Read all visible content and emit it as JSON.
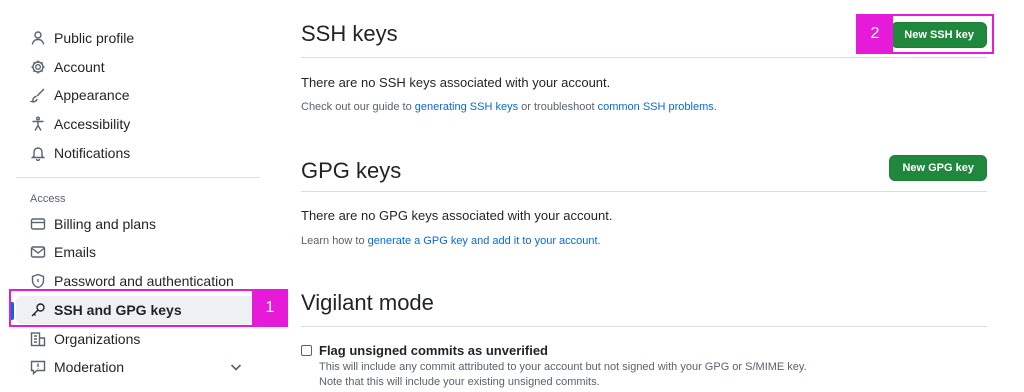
{
  "sidebar": {
    "items_top": [
      {
        "label": "Public profile",
        "icon": "person-icon"
      },
      {
        "label": "Account",
        "icon": "gear-icon"
      },
      {
        "label": "Appearance",
        "icon": "paintbrush-icon"
      },
      {
        "label": "Accessibility",
        "icon": "accessibility-icon"
      },
      {
        "label": "Notifications",
        "icon": "bell-icon"
      }
    ],
    "access_heading": "Access",
    "items_access": [
      {
        "label": "Billing and plans",
        "icon": "credit-card-icon"
      },
      {
        "label": "Emails",
        "icon": "mail-icon"
      },
      {
        "label": "Password and authentication",
        "icon": "shield-lock-icon"
      },
      {
        "label": "SSH and GPG keys",
        "icon": "key-icon",
        "active": true
      },
      {
        "label": "Organizations",
        "icon": "organization-icon"
      },
      {
        "label": "Moderation",
        "icon": "report-icon",
        "expandable": true
      }
    ]
  },
  "annotations": {
    "badge1": "1",
    "badge2": "2",
    "color": "#e61ad9"
  },
  "ssh": {
    "title": "SSH keys",
    "button": "New SSH key",
    "empty": "There are no SSH keys associated with your account.",
    "guide_prefix": "Check out our guide to ",
    "guide_link1": "generating SSH keys",
    "guide_mid": " or troubleshoot ",
    "guide_link2": "common SSH problems",
    "guide_suffix": "."
  },
  "gpg": {
    "title": "GPG keys",
    "button": "New GPG key",
    "empty": "There are no GPG keys associated with your account.",
    "learn_prefix": "Learn how to ",
    "learn_link": "generate a GPG key and add it to your account",
    "learn_suffix": "."
  },
  "vigilant": {
    "title": "Vigilant mode",
    "checkbox_label": "Flag unsigned commits as unverified",
    "checked": false,
    "desc1": "This will include any commit attributed to your account but not signed with your GPG or S/MIME key.",
    "desc2": "Note that this will include your existing unsigned commits."
  },
  "colors": {
    "accent": "#0969da",
    "primary_button": "#1f883d",
    "annotation": "#e61ad9"
  }
}
